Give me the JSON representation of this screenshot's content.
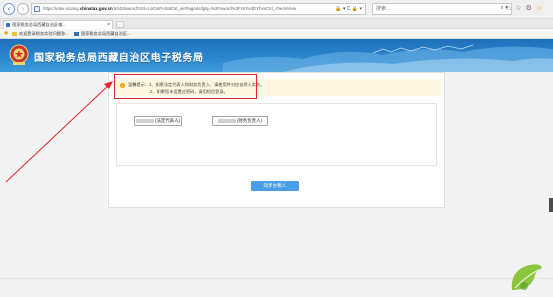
{
  "browser": {
    "url_prefix": "https://etax-xizang.",
    "url_domain": "chinatax.gov.cn",
    "url_suffix": ":8443/sword?ctrl=LoGinPortalCtrl_initPage&rdg6j=%2Fsword%3Fctrl%3DYhxxCtrl_checkView",
    "addr_tools": "🔒 ▾ C 🔒 ▾",
    "search_placeholder": "搜索...",
    "tab_title": "国家税务总局西藏自治区电...",
    "favorites": [
      "欢迎登录税务实验问题答...",
      "国家税务总局西藏自治区..."
    ]
  },
  "header": {
    "title": "国家税务总局西藏自治区电子税务局"
  },
  "notice": {
    "icon_glyph": "!",
    "line1": "温馨提示：1、如果法定代表人和财务负责人、请使用并对应自然人实名。",
    "line2": "2、如果您未设置过密码，请用短信登录。"
  },
  "roles": {
    "legal_label": "(法定代表人)",
    "finance_label": "(财务负责人)"
  },
  "sync_button": "同步办税人",
  "colors": {
    "header_blue": "#2b86cf",
    "annotation_red": "#e0262b",
    "button_blue": "#4a9ee6",
    "notice_bg": "#fdf6e0"
  }
}
